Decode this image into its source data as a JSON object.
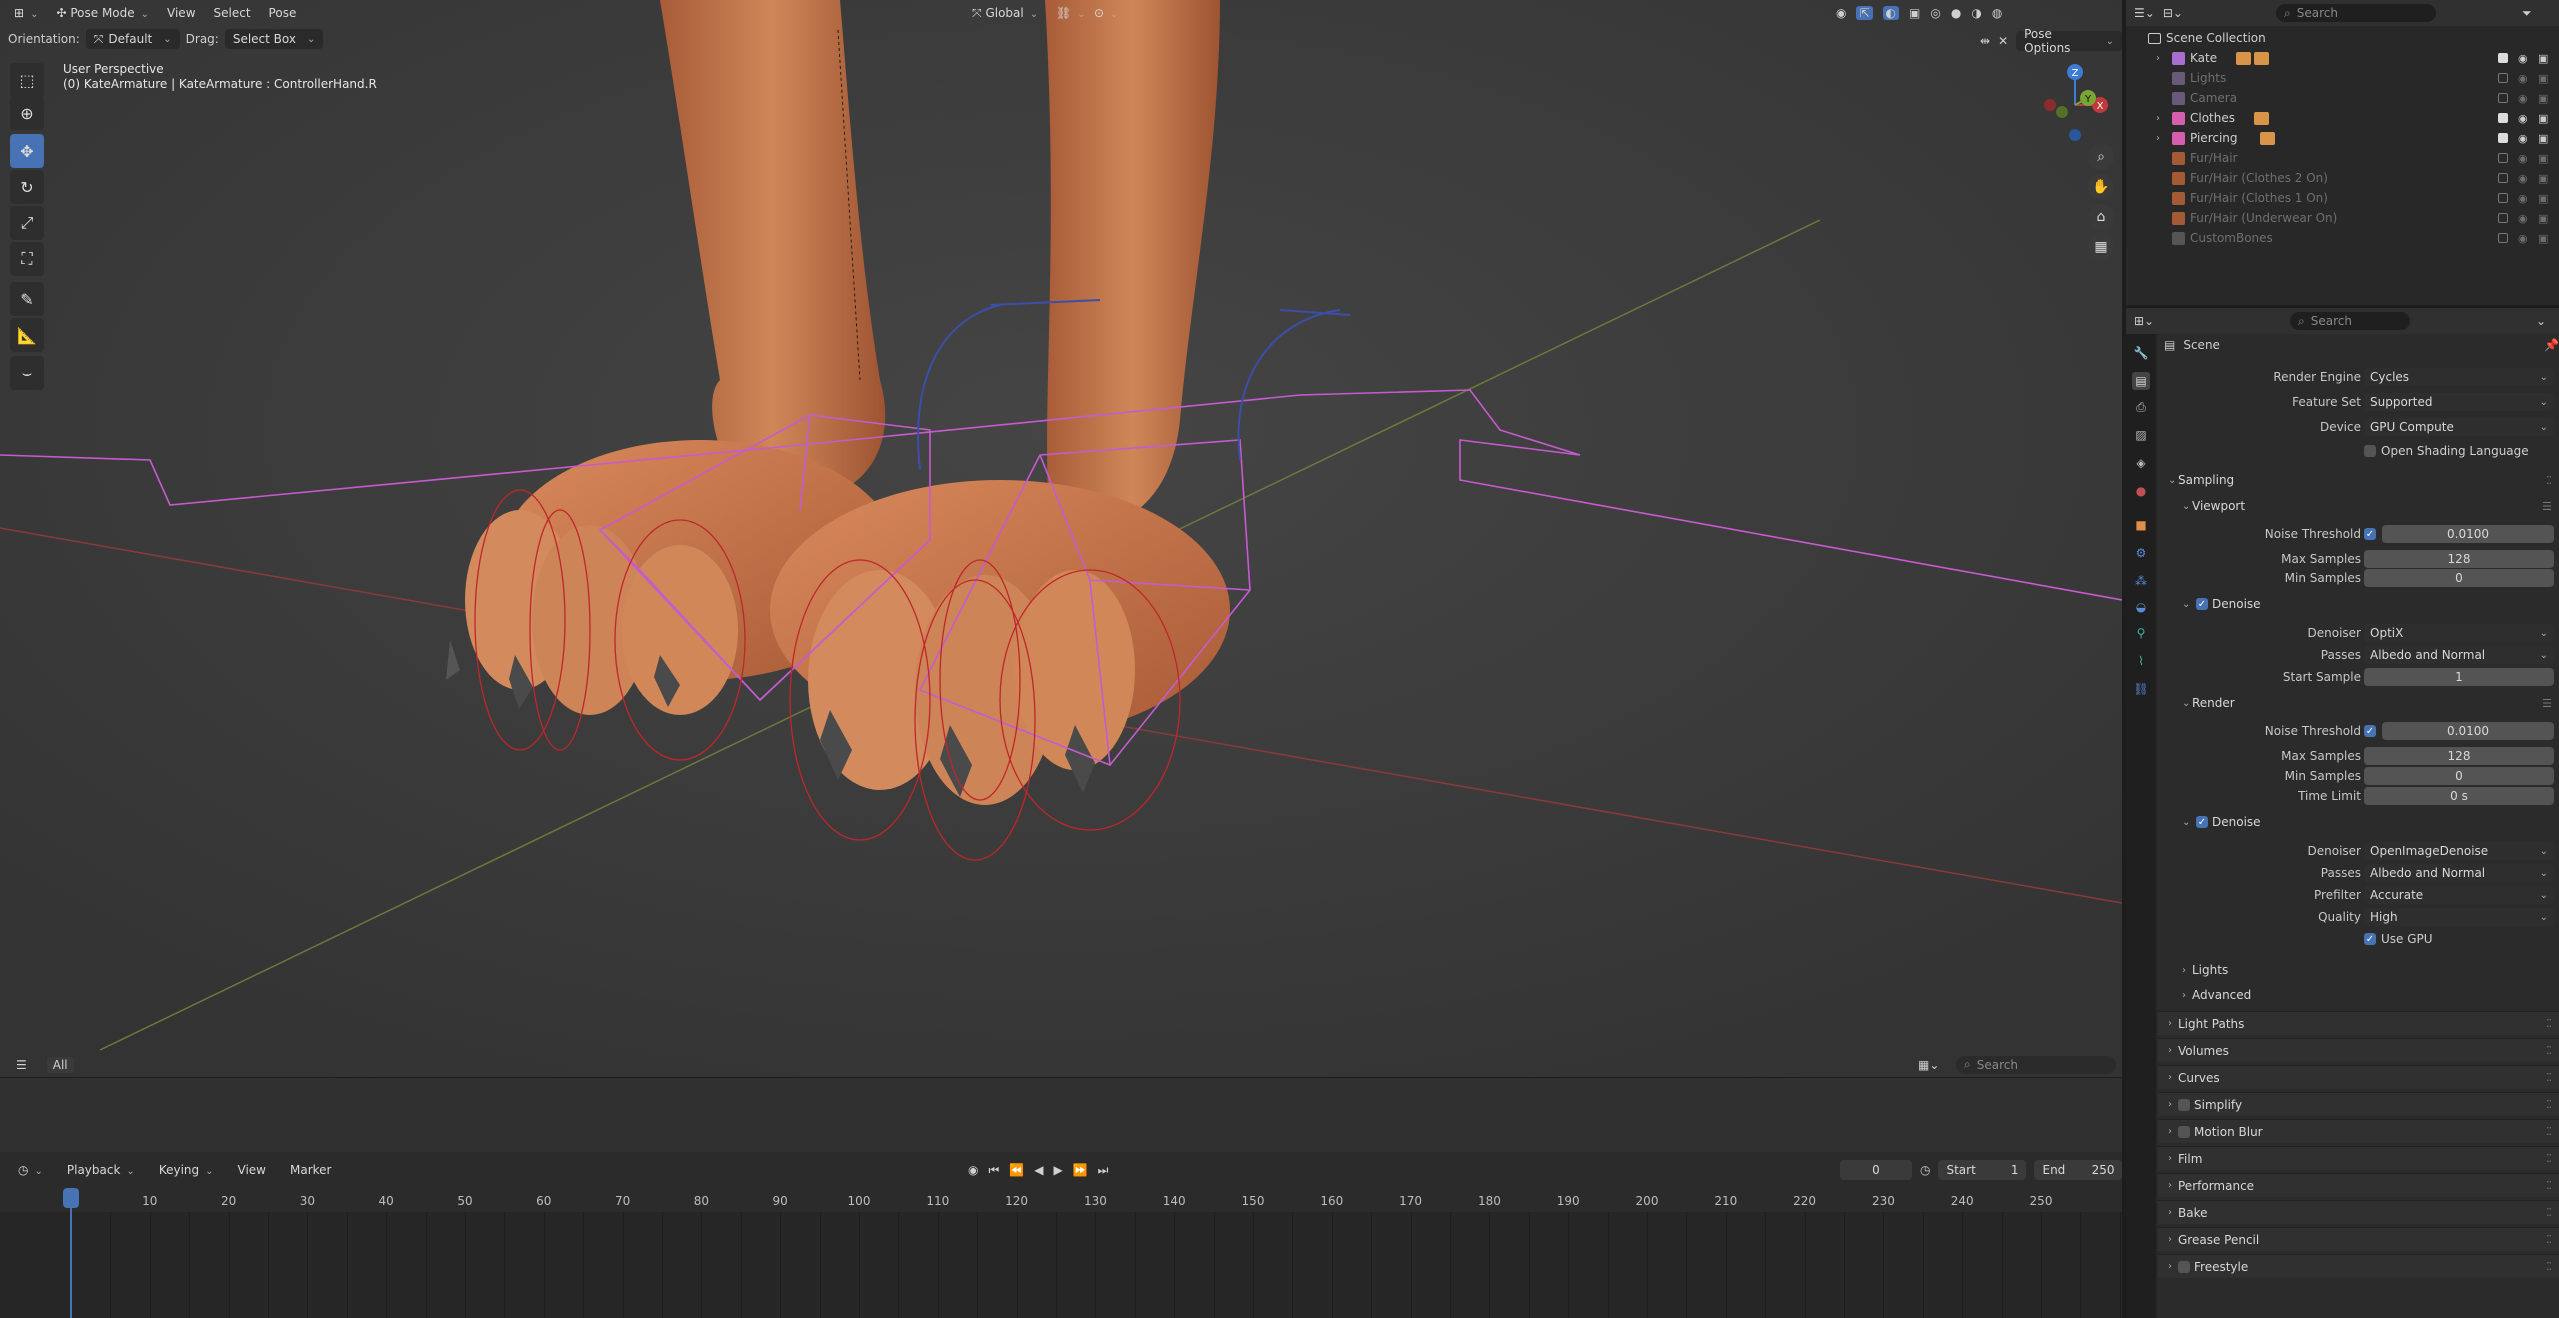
{
  "viewport": {
    "header": {
      "mode": "Pose Mode",
      "menus": [
        "View",
        "Select",
        "Pose"
      ],
      "transform_orientation": "Global",
      "pose_options": "Pose Options"
    },
    "tool_settings": {
      "orientation_label": "Orientation:",
      "orientation_value": "Default",
      "drag_label": "Drag:",
      "drag_value": "Select Box"
    },
    "overlay_text": {
      "line1": "User Perspective",
      "line2": "(0) KateArmature | KateArmature : ControllerHand.R"
    },
    "gizmo": {
      "x": "X",
      "y": "Y",
      "z": "Z"
    },
    "footer": {
      "filter_label": "All",
      "search_placeholder": "Search"
    }
  },
  "timeline": {
    "menus": [
      "Playback",
      "Keying",
      "View",
      "Marker"
    ],
    "current_frame": "0",
    "start_label": "Start",
    "start_value": "1",
    "end_label": "End",
    "end_value": "250",
    "ruler": [
      "0",
      "10",
      "20",
      "30",
      "40",
      "50",
      "60",
      "70",
      "80",
      "90",
      "100",
      "110",
      "120",
      "130",
      "140",
      "150",
      "160",
      "170",
      "180",
      "190",
      "200",
      "210",
      "220",
      "230",
      "240",
      "250"
    ]
  },
  "outliner": {
    "search_placeholder": "Search",
    "root": "Scene Collection",
    "items": [
      {
        "name": "Kate",
        "color": "#a86fd0",
        "expandable": true,
        "enabled": true,
        "badges": 2
      },
      {
        "name": "Lights",
        "color": "#6a5a7a",
        "expandable": false,
        "enabled": false,
        "badges": 0
      },
      {
        "name": "Camera",
        "color": "#6a5a7a",
        "expandable": false,
        "enabled": false,
        "badges": 0
      },
      {
        "name": "Clothes",
        "color": "#d45fae",
        "expandable": true,
        "enabled": true,
        "badges": 1
      },
      {
        "name": "Piercing",
        "color": "#d45fae",
        "expandable": true,
        "enabled": true,
        "badges": 1
      },
      {
        "name": "Fur/Hair",
        "color": "#a35a35",
        "expandable": false,
        "enabled": false,
        "badges": 0
      },
      {
        "name": "Fur/Hair (Clothes 2 On)",
        "color": "#a35a35",
        "expandable": false,
        "enabled": false,
        "badges": 0
      },
      {
        "name": "Fur/Hair (Clothes 1 On)",
        "color": "#a35a35",
        "expandable": false,
        "enabled": false,
        "badges": 0
      },
      {
        "name": "Fur/Hair (Underwear On)",
        "color": "#a35a35",
        "expandable": false,
        "enabled": false,
        "badges": 0
      },
      {
        "name": "CustomBones",
        "color": "#555555",
        "expandable": false,
        "enabled": false,
        "badges": 0
      }
    ]
  },
  "properties": {
    "search_placeholder": "Search",
    "context": "Scene",
    "render_engine": {
      "label": "Render Engine",
      "value": "Cycles"
    },
    "feature_set": {
      "label": "Feature Set",
      "value": "Supported"
    },
    "device": {
      "label": "Device",
      "value": "GPU Compute"
    },
    "osl": "Open Shading Language",
    "sampling": "Sampling",
    "viewport_sub": "Viewport",
    "vp_noise_threshold": {
      "label": "Noise Threshold",
      "value": "0.0100"
    },
    "vp_max_samples": {
      "label": "Max Samples",
      "value": "128"
    },
    "vp_min_samples": {
      "label": "Min Samples",
      "value": "0"
    },
    "vp_denoise": "Denoise",
    "vp_denoiser": {
      "label": "Denoiser",
      "value": "OptiX"
    },
    "vp_passes": {
      "label": "Passes",
      "value": "Albedo and Normal"
    },
    "vp_start_sample": {
      "label": "Start Sample",
      "value": "1"
    },
    "render_sub": "Render",
    "r_noise_threshold": {
      "label": "Noise Threshold",
      "value": "0.0100"
    },
    "r_max_samples": {
      "label": "Max Samples",
      "value": "128"
    },
    "r_min_samples": {
      "label": "Min Samples",
      "value": "0"
    },
    "r_time_limit": {
      "label": "Time Limit",
      "value": "0 s"
    },
    "r_denoise": "Denoise",
    "r_denoiser": {
      "label": "Denoiser",
      "value": "OpenImageDenoise"
    },
    "r_passes": {
      "label": "Passes",
      "value": "Albedo and Normal"
    },
    "r_prefilter": {
      "label": "Prefilter",
      "value": "Accurate"
    },
    "r_quality": {
      "label": "Quality",
      "value": "High"
    },
    "use_gpu": "Use GPU",
    "lights_sub": "Lights",
    "advanced_sub": "Advanced",
    "panels": [
      "Light Paths",
      "Volumes",
      "Curves",
      "Simplify",
      "Motion Blur",
      "Film",
      "Performance",
      "Bake",
      "Grease Pencil",
      "Freestyle"
    ]
  }
}
